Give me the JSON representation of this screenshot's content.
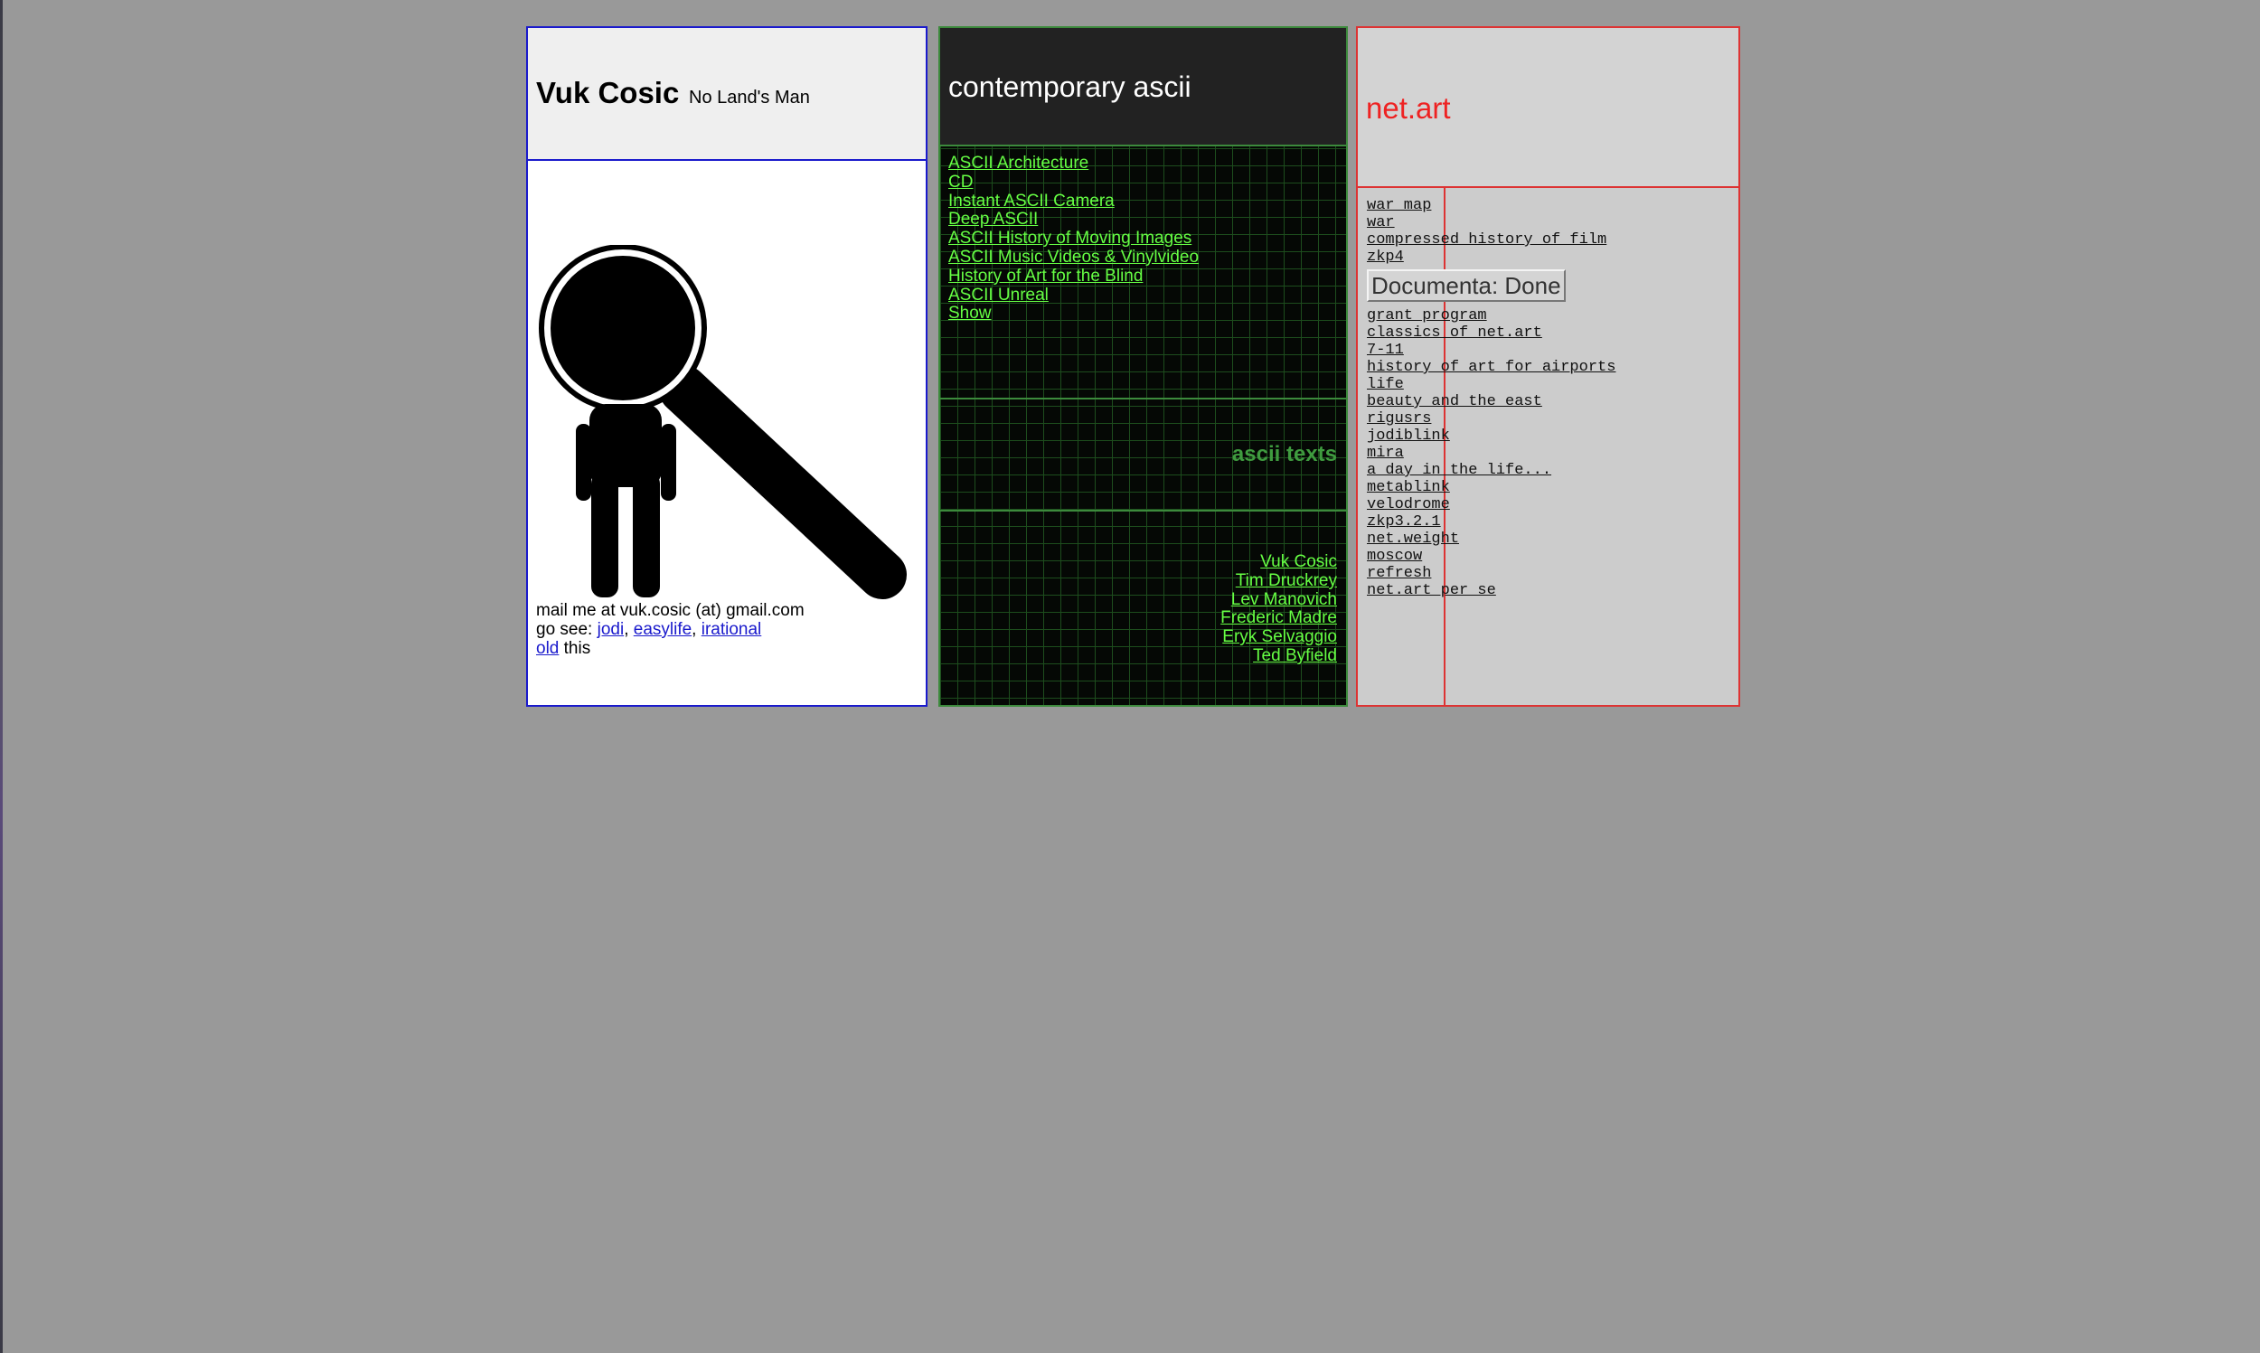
{
  "colors": {
    "page_background": "#999999",
    "profile_border": "#1a1acc",
    "ascii_border": "#3c8a3c",
    "ascii_link": "#66ff44",
    "netart_border": "#dd3333",
    "netart_title": "#ee2222"
  },
  "profile": {
    "name": "Vuk Cosic",
    "tagline": "No Land's Man",
    "illustration_icon": "magnifier-person-icon",
    "mail_line": "mail me at vuk.cosic (at) gmail.com",
    "go_see_prefix": "go see:",
    "go_see_links": [
      "jodi",
      "easylife",
      "irational"
    ],
    "separator": ",",
    "old_link": "old",
    "old_suffix": "this"
  },
  "ascii": {
    "title": "contemporary ascii",
    "links": [
      "ASCII Architecture",
      "CD",
      "Instant ASCII Camera",
      "Deep ASCII",
      "ASCII History of Moving Images",
      "ASCII Music Videos & Vinylvideo",
      "History of Art for the Blind",
      "ASCII Unreal",
      "Show"
    ],
    "texts_label": "ascii texts",
    "authors": [
      "Vuk Cosic",
      "Tim Druckrey",
      "Lev Manovich",
      "Frederic Madre",
      "Eryk Selvaggio",
      "Ted Byfield"
    ]
  },
  "netart": {
    "title": "net.art",
    "links_before": [
      "war map",
      "war",
      "compressed history of film",
      "zkp4"
    ],
    "button_label": "Documenta: Done",
    "links_after": [
      "grant program",
      "classics of net.art",
      "7-11",
      "history of art for airports",
      "life",
      "beauty and the east",
      "rigusrs",
      "jodiblink",
      "mira",
      "a day in the life...",
      "metablink",
      "velodrome",
      "zkp3.2.1",
      "net.weight",
      "moscow",
      "refresh",
      "net.art per se"
    ]
  }
}
